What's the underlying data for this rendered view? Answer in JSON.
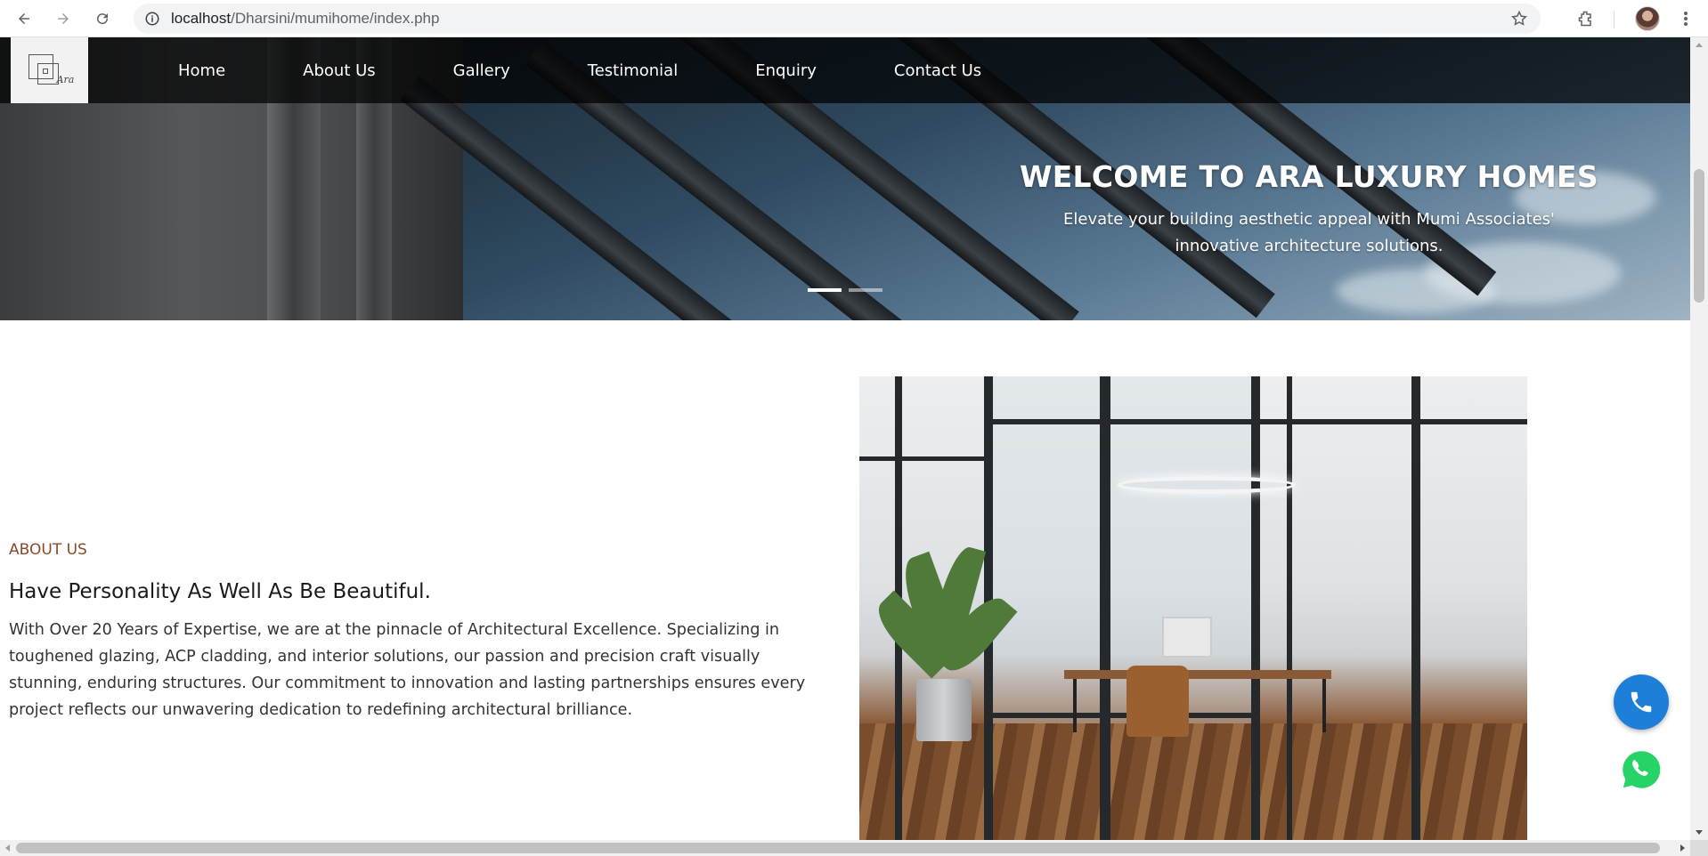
{
  "browser": {
    "url_host": "localhost",
    "url_path": "/Dharsini/mumihome/index.php",
    "icons": [
      "back-icon",
      "forward-icon",
      "reload-icon",
      "site-info-icon",
      "bookmark-star-icon",
      "extensions-icon",
      "profile-avatar",
      "kebab-menu-icon"
    ]
  },
  "nav": {
    "logo_text": "Ara",
    "items": [
      {
        "label": "Home"
      },
      {
        "label": "About Us"
      },
      {
        "label": "Gallery"
      },
      {
        "label": "Testimonial"
      },
      {
        "label": "Enquiry"
      },
      {
        "label": "Contact Us"
      }
    ]
  },
  "hero": {
    "title": "WELCOME TO ARA LUXURY HOMES",
    "subtitle_line1": "Elevate your building aesthetic appeal with Mumi Associates'",
    "subtitle_line2": "innovative architecture solutions.",
    "slides": [
      {
        "active": true
      },
      {
        "active": false
      }
    ]
  },
  "about": {
    "kicker": "ABOUT US",
    "heading": "Have Personality As Well As Be Beautiful.",
    "body": "With Over 20 Years of Expertise, we are at the pinnacle of Architectural Excellence. Specializing in toughened glazing, ACP cladding, and interior solutions, our passion and precision craft visually stunning, enduring structures. Our commitment to innovation and lasting partnerships ensures every project reflects our unwavering dedication to redefining architectural brilliance."
  },
  "floating": {
    "phone_icon": "phone-icon",
    "whatsapp_icon": "whatsapp-icon"
  },
  "colors": {
    "kicker": "#8a4a2a",
    "phone_button": "#1e7fd8",
    "whatsapp": "#25d366",
    "header_bg": "#000000"
  }
}
